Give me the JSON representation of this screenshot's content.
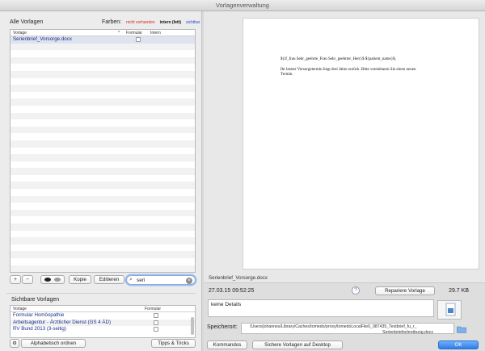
{
  "window": {
    "title": "Vorlagenverwaltung"
  },
  "all_templates": {
    "title": "Alle Vorlagen",
    "colors_label": "Farben:",
    "legend": [
      {
        "label": "nicht vorhanden",
        "color": "#d62828"
      },
      {
        "label": "intern (fett)",
        "color": "#111111"
      },
      {
        "label": "sichtbar",
        "color": "#2b49c8"
      }
    ],
    "columns": [
      "Vorlage",
      "Formular",
      "Intern"
    ],
    "rows": [
      {
        "name": "Serienbrief_Vorsorge.docx",
        "formular": false,
        "selected": true
      }
    ]
  },
  "toolbar": {
    "add": "+",
    "remove": "−",
    "copy": "Kopie",
    "edit": "Editieren",
    "search_value": "seri"
  },
  "visible_templates": {
    "title": "Sichtbare Vorlagen",
    "columns": [
      "Vorlage",
      "Formular"
    ],
    "rows": [
      {
        "name": "Formular Homöopathie"
      },
      {
        "name": "Arbeitsagentur - Ärztlicher Dienst (GS 4 ÄD)"
      },
      {
        "name": "RV Bund 2013 (3-seitig)"
      }
    ],
    "sort_button": "Alphabetisch ordnen",
    "tips_button": "Tipps & Tricks"
  },
  "preview": {
    "line1": "${if_frau Sehr_geehrte_Frau Sehr_geehrter_Herr}$ ${patient_name}$,",
    "line2": "Ihr letzter Vorsorgetermin liegt drei Jahre zurück. Bitte vereinbaren Sie einen neuen",
    "line3": "Termin."
  },
  "details": {
    "filename": "Serienbrief_Vorsorge.docx",
    "date": "27.03.15 09:52:25",
    "help": "?",
    "repair_button": "Repariere Vorlage",
    "size": "29.7 KB",
    "details_text": "keine Details",
    "storage_label": "Speicherort:",
    "path_line1": "/Users/johannes/Library/Caches/tomedo/proxy/tomedoLocalFile0_987435_Testbrief_fu_r_",
    "path_line2": "Serienbriefschreibung.docx"
  },
  "footer": {
    "commands_button": "Kommandos",
    "save_desktop_button": "Sichere Vorlagen auf Desktop",
    "ok_button": "OK"
  }
}
